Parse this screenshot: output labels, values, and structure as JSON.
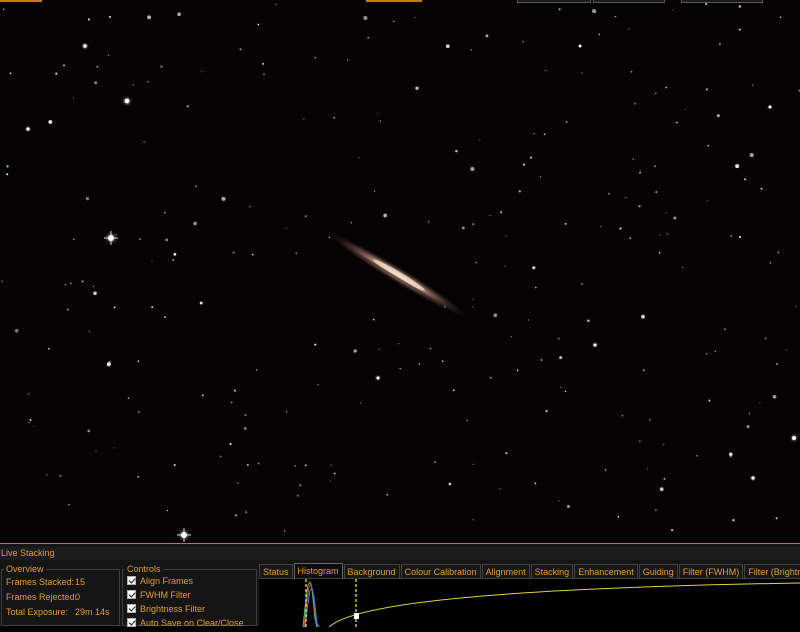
{
  "panel": {
    "title": "Live Stacking"
  },
  "overview": {
    "title": "Overview",
    "rows": [
      {
        "label": "Frames Stacked:",
        "value": "15"
      },
      {
        "label": "Frames Rejected:",
        "value": "0"
      },
      {
        "label": "Total Exposure:",
        "value": "29m 14s"
      }
    ]
  },
  "controls": {
    "title": "Controls",
    "items": [
      {
        "label": "Align Frames",
        "checked": true
      },
      {
        "label": "FWHM Filter",
        "checked": true
      },
      {
        "label": "Brightness Filter",
        "checked": true
      },
      {
        "label": "Auto Save on Clear/Close",
        "checked": true
      }
    ]
  },
  "tabs": [
    "Status",
    "Histogram",
    "Background",
    "Colour Calibration",
    "Alignment",
    "Stacking",
    "Enhancement",
    "Guiding",
    "Filter (FWHM)",
    "Filter (Brightness)"
  ],
  "active_tab": "Histogram",
  "colors": {
    "accent": "#e59a2c",
    "panel_bg": "#151515",
    "sky_bg": "#050203"
  }
}
